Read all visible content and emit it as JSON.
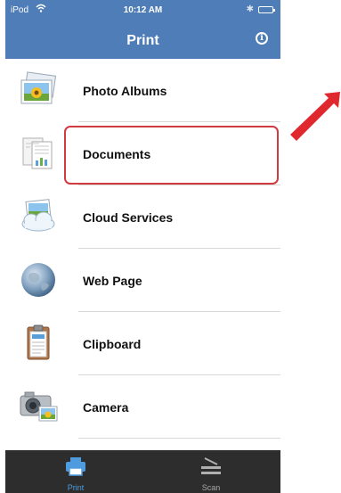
{
  "status": {
    "carrier": "iPod",
    "time": "10:12 AM"
  },
  "nav": {
    "title": "Print"
  },
  "items": [
    {
      "label": "Photo Albums",
      "icon": "photo-albums-icon"
    },
    {
      "label": "Documents",
      "icon": "documents-icon"
    },
    {
      "label": "Cloud Services",
      "icon": "cloud-services-icon"
    },
    {
      "label": "Web Page",
      "icon": "globe-icon"
    },
    {
      "label": "Clipboard",
      "icon": "clipboard-icon"
    },
    {
      "label": "Camera",
      "icon": "camera-icon"
    }
  ],
  "tabs": [
    {
      "label": "Print",
      "icon": "printer-icon",
      "selected": true
    },
    {
      "label": "Scan",
      "icon": "scanner-icon",
      "selected": false
    }
  ],
  "colors": {
    "header": "#4f7db7",
    "tabbar": "#2d2d2d",
    "active_tab": "#4f9be0",
    "highlight": "#d33a3f"
  }
}
